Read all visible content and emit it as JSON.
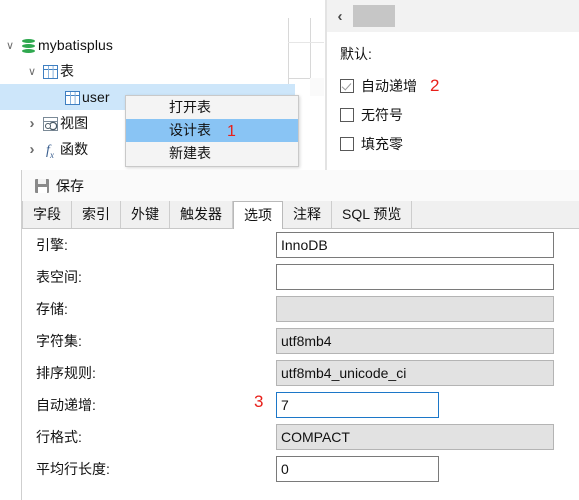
{
  "tree": {
    "items": [
      {
        "label": "mybatisplus",
        "icon": "database-icon",
        "expander": "chevron-down-icon",
        "indent": 10,
        "selected": false
      },
      {
        "label": "表",
        "icon": "table-icon",
        "expander": "chevron-down-icon",
        "indent": 32,
        "selected": false
      },
      {
        "label": "user",
        "icon": "table-icon",
        "expander": "none",
        "indent": 54,
        "selected": true
      },
      {
        "label": "视图",
        "icon": "view-icon",
        "expander": "chevron-right-icon",
        "indent": 32,
        "selected": false
      },
      {
        "label": "函数",
        "icon": "function-fx-icon",
        "expander": "chevron-right-icon",
        "indent": 32,
        "selected": false
      }
    ]
  },
  "context_menu": {
    "items": [
      {
        "label": "打开表",
        "highlighted": false,
        "marker": ""
      },
      {
        "label": "设计表",
        "highlighted": true,
        "marker": "1"
      },
      {
        "label": "新建表",
        "highlighted": false,
        "marker": ""
      }
    ]
  },
  "property_pane": {
    "back_label": "‹",
    "section_label": "默认:",
    "checkboxes": [
      {
        "label": "自动递增",
        "checked": true,
        "marker": "2"
      },
      {
        "label": "无符号",
        "checked": false,
        "marker": ""
      },
      {
        "label": "填充零",
        "checked": false,
        "marker": ""
      }
    ]
  },
  "designer": {
    "toolbar": {
      "save_label": "保存"
    },
    "tabs": [
      {
        "label": "字段",
        "active": false
      },
      {
        "label": "索引",
        "active": false
      },
      {
        "label": "外键",
        "active": false
      },
      {
        "label": "触发器",
        "active": false
      },
      {
        "label": "选项",
        "active": true
      },
      {
        "label": "注释",
        "active": false
      },
      {
        "label": "SQL 预览",
        "active": false
      }
    ],
    "fields": [
      {
        "label": "引擎:",
        "value": "InnoDB",
        "readonly": false,
        "focused": false,
        "wide": true,
        "marker": ""
      },
      {
        "label": "表空间:",
        "value": "",
        "readonly": false,
        "focused": false,
        "wide": true,
        "marker": ""
      },
      {
        "label": "存储:",
        "value": "",
        "readonly": true,
        "focused": false,
        "wide": true,
        "marker": ""
      },
      {
        "label": "字符集:",
        "value": "utf8mb4",
        "readonly": true,
        "focused": false,
        "wide": true,
        "marker": ""
      },
      {
        "label": "排序规则:",
        "value": "utf8mb4_unicode_ci",
        "readonly": true,
        "focused": false,
        "wide": true,
        "marker": ""
      },
      {
        "label": "自动递增:",
        "value": "7",
        "readonly": false,
        "focused": true,
        "wide": false,
        "marker": "3"
      },
      {
        "label": "行格式:",
        "value": "COMPACT",
        "readonly": true,
        "focused": false,
        "wide": true,
        "marker": ""
      },
      {
        "label": "平均行长度:",
        "value": "0",
        "readonly": false,
        "focused": false,
        "wide": false,
        "marker": ""
      }
    ]
  },
  "colors": {
    "selection_blue": "#cde6fa",
    "menu_highlight": "#89c4f4",
    "marker_red": "#e8201a",
    "focus_border": "#1c77c8",
    "readonly_bg": "#e2e2e2"
  }
}
